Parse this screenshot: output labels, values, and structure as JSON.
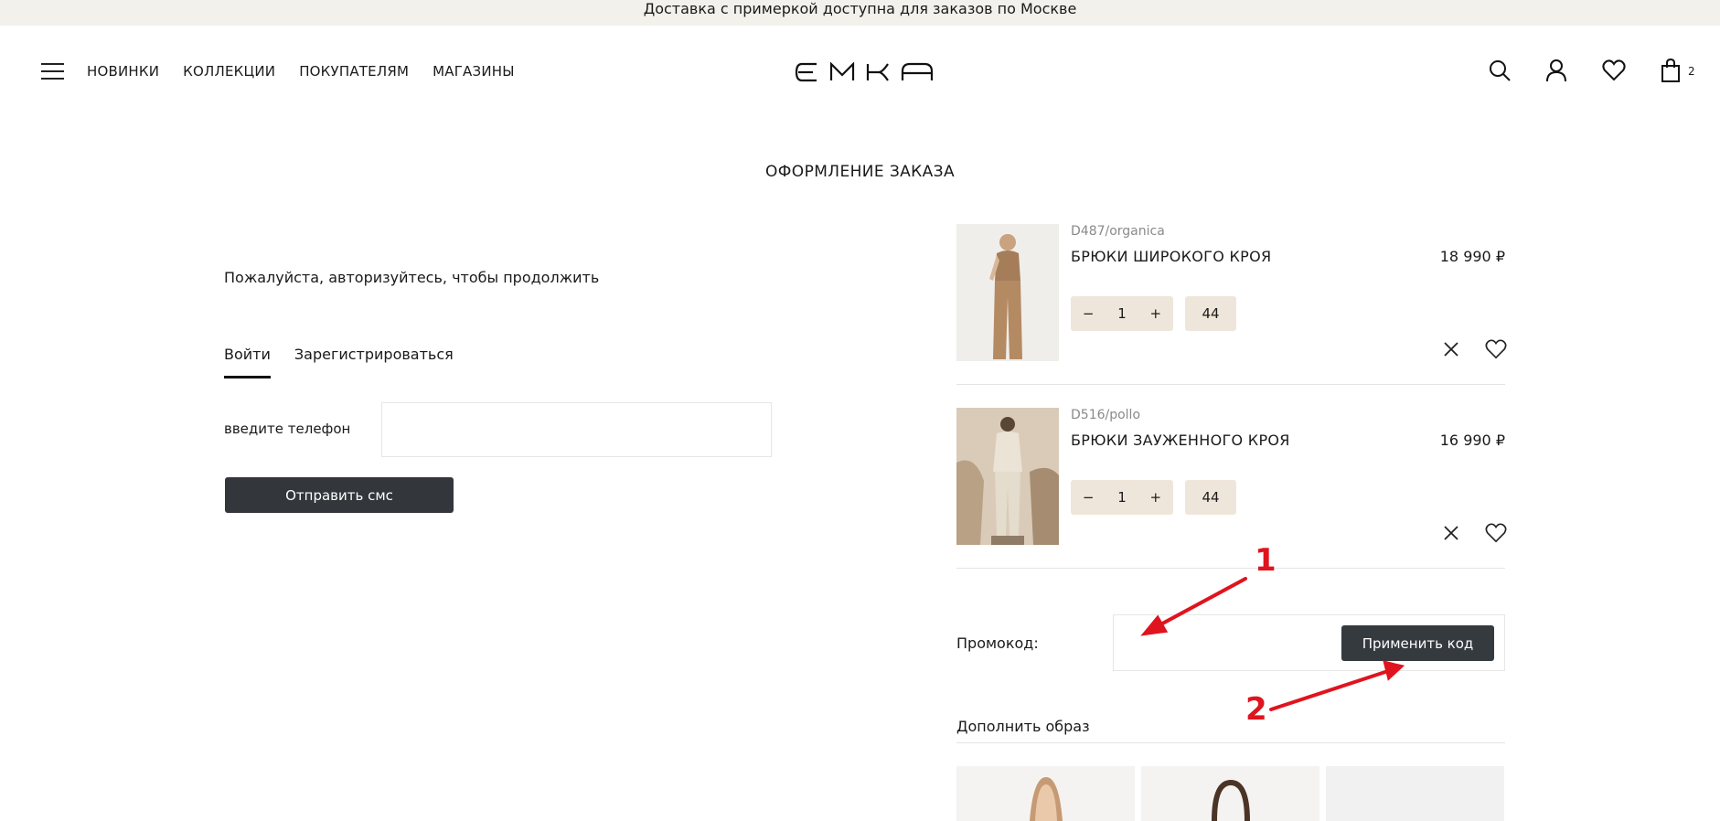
{
  "topbar": {
    "text": "Доставка с примеркой доступна для заказов по Москве"
  },
  "header": {
    "nav": [
      "НОВИНКИ",
      "КОЛЛЕКЦИИ",
      "ПОКУПАТЕЛЯМ",
      "МАГАЗИНЫ"
    ],
    "logo": "EMKA",
    "cart_count": "2",
    "icons": [
      "menu-icon",
      "search-icon",
      "account-icon",
      "heart-icon",
      "bag-icon"
    ]
  },
  "page": {
    "title": "ОФОРМЛЕНИЕ ЗАКАЗА"
  },
  "auth": {
    "message": "Пожалуйста, авторизуйтесь, чтобы продолжить",
    "tabs": [
      "Войти",
      "Зарегистрироваться"
    ],
    "active_tab": "Войти",
    "phone_label": "введите телефон",
    "phone_value": "",
    "send_sms": "Отправить смс"
  },
  "cart": {
    "items": [
      {
        "sku": "D487/organica",
        "name": "БРЮКИ ШИРОКОГО КРОЯ",
        "price": "18 990 ₽",
        "qty": "1",
        "size": "44"
      },
      {
        "sku": "D516/pollo",
        "name": "БРЮКИ ЗАУЖЕННОГО КРОЯ",
        "price": "16 990 ₽",
        "qty": "1",
        "size": "44"
      }
    ],
    "qty_minus": "−",
    "qty_plus": "+"
  },
  "promo": {
    "label": "Промокод:",
    "value": "",
    "apply": "Применить код"
  },
  "complete_look": {
    "title": "Дополнить образ"
  },
  "annotations": {
    "marker_1": "1",
    "marker_2": "2",
    "color": "#e0141e"
  },
  "colors": {
    "button_dark": "#33373b",
    "chip_beige": "#efe6db",
    "topbar_bg": "#f3f1ec"
  }
}
